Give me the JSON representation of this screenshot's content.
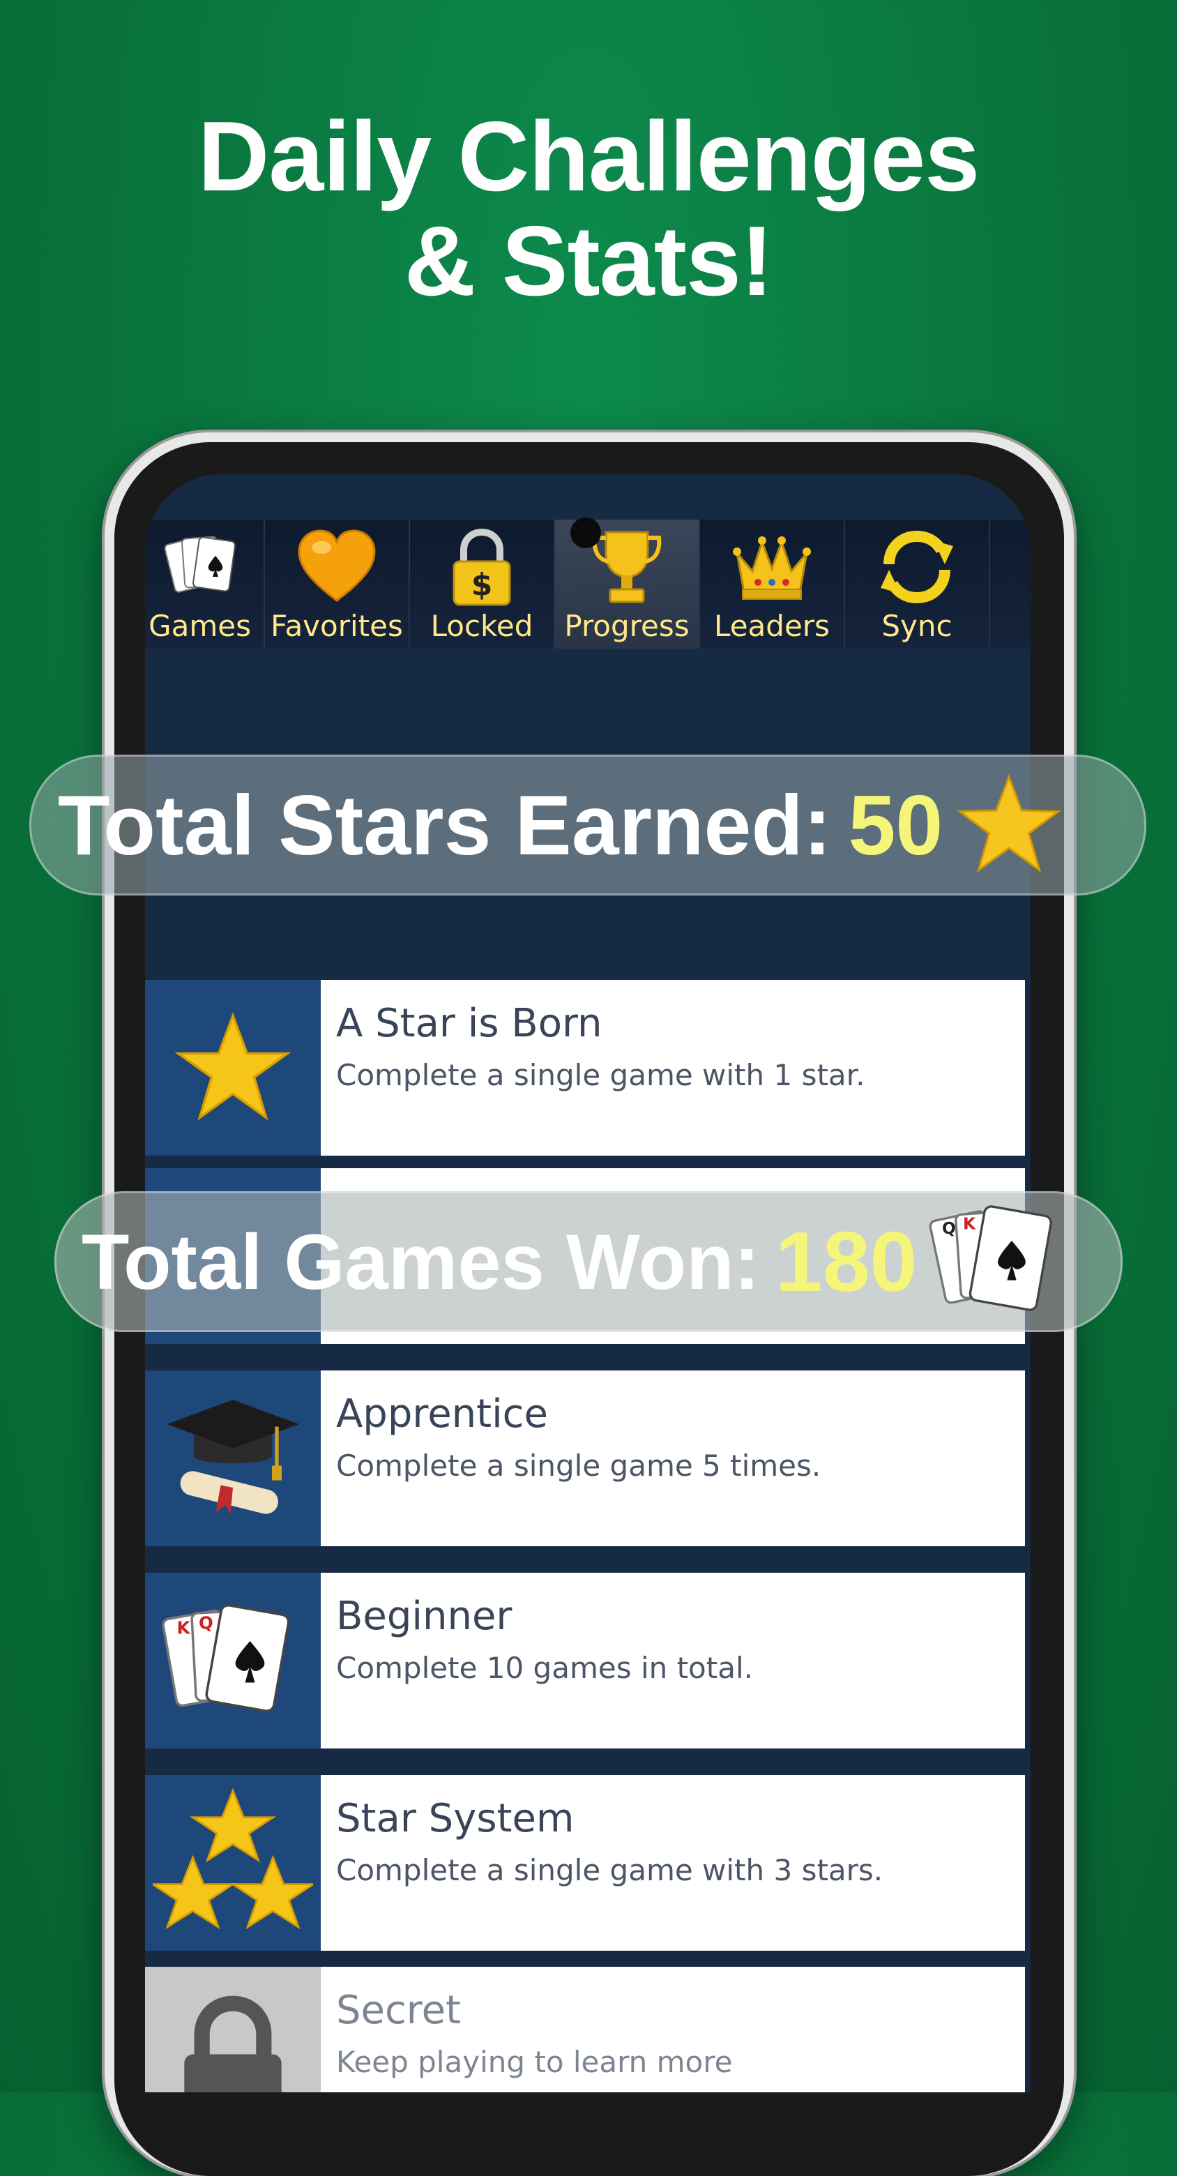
{
  "headline": {
    "line1": "Daily Challenges",
    "line2": "& Stats!"
  },
  "tabs": [
    {
      "label": "Games",
      "icon": "playing-cards-icon"
    },
    {
      "label": "Favorites",
      "icon": "heart-icon"
    },
    {
      "label": "Locked",
      "icon": "padlock-dollar-icon"
    },
    {
      "label": "Progress",
      "icon": "trophy-icon",
      "active": true
    },
    {
      "label": "Leaders",
      "icon": "crown-icon"
    },
    {
      "label": "Sync",
      "icon": "sync-arrows-icon"
    }
  ],
  "stats": {
    "stars_label": "Total Stars Earned:",
    "stars_value": "50",
    "games_label": "Total Games Won:",
    "games_value": "180"
  },
  "achievements": [
    {
      "title": "A Star is Born",
      "desc": "Complete a single game with 1 star.",
      "icon": "star-icon"
    },
    {
      "title": "Apprentice",
      "desc": "Complete a single game 5 times.",
      "icon": "graduation-cap-icon"
    },
    {
      "title": "Beginner",
      "desc": "Complete 10 games in total.",
      "icon": "playing-cards-icon"
    },
    {
      "title": "Star System",
      "desc": "Complete a single game with 3 stars.",
      "icon": "three-stars-icon"
    },
    {
      "title": "Secret",
      "desc": "Keep playing to learn more",
      "icon": "padlock-icon"
    }
  ],
  "colors": {
    "background": "#0a7a40",
    "tab_label": "#ffe989",
    "stat_value": "#f5f57a",
    "icon_tile": "#1e477a",
    "star": "#f5c518"
  }
}
